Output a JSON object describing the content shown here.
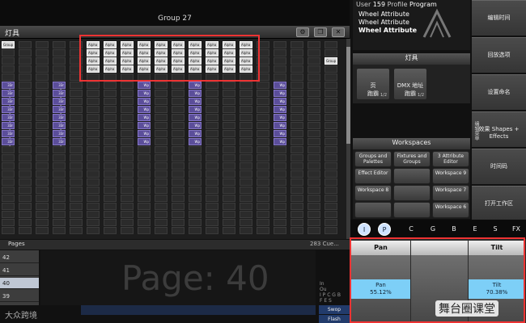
{
  "window": {
    "group_title": "Group 27",
    "pane_title": "灯具"
  },
  "profile": {
    "user_label": "User",
    "user_value": "159",
    "profile_label": "Profile",
    "profile_value": "Program",
    "attributes": [
      "Wheel Attribute",
      "Wheel Attribute",
      "Wheel Attribute"
    ]
  },
  "fixtures_panel": {
    "title": "灯具",
    "btn_page": "页\n跑霸",
    "btn_page_sub": "1/2",
    "btn_dmx": "DMX 地址\n跑霸",
    "btn_dmx_sub": "1/2"
  },
  "workspaces": {
    "title": "Workspaces",
    "items": [
      {
        "label": "Groups and Palettes"
      },
      {
        "label": "Fixtures and Groups"
      },
      {
        "label": "3 Attribute Editor"
      },
      {
        "label": "Effect Editor"
      },
      {
        "label": ""
      },
      {
        "label": "Workspace 9"
      },
      {
        "label": "Workspace 8"
      },
      {
        "label": ""
      },
      {
        "label": "Workspace 7"
      },
      {
        "label": ""
      },
      {
        "label": ""
      },
      {
        "label": "Workspace 6"
      }
    ]
  },
  "side_buttons": [
    "编辑时间",
    "回放选项",
    "设置命名",
    "效果 Shapes + Effects",
    "时间码",
    "打开工作区"
  ],
  "side_vertical": "编辑菜单",
  "attr_tabs": [
    "I",
    "P",
    "C",
    "G",
    "B",
    "E",
    "S",
    "FX"
  ],
  "encoders": [
    {
      "name": "Pan",
      "value_name": "Pan",
      "value": "55.12%"
    },
    {
      "name": "",
      "value_name": "",
      "value": ""
    },
    {
      "name": "Tilt",
      "value_name": "Tilt",
      "value": "70.38%"
    }
  ],
  "pages": {
    "label": "Pages",
    "numbers": [
      "42",
      "41",
      "40",
      "39"
    ],
    "big": "Page: 40",
    "cue_count": "283 Cue..."
  },
  "inout": [
    "In",
    "Ou",
    "I P C G B",
    "F  E S"
  ],
  "swop": [
    "Swop",
    "Flash"
  ],
  "grid_labels": {
    "alpha": "Alpha B",
    "wp": "Wp",
    "group": "Group",
    "grp": "Grp",
    "sp": "33r Sp"
  },
  "watermarks": {
    "left": "大众跨境",
    "right": "舞台圈课堂"
  },
  "colors": {
    "highlight": "#e33333",
    "fixture_selected": "#5b4e9a",
    "encoder_value": "#7dcff7"
  }
}
